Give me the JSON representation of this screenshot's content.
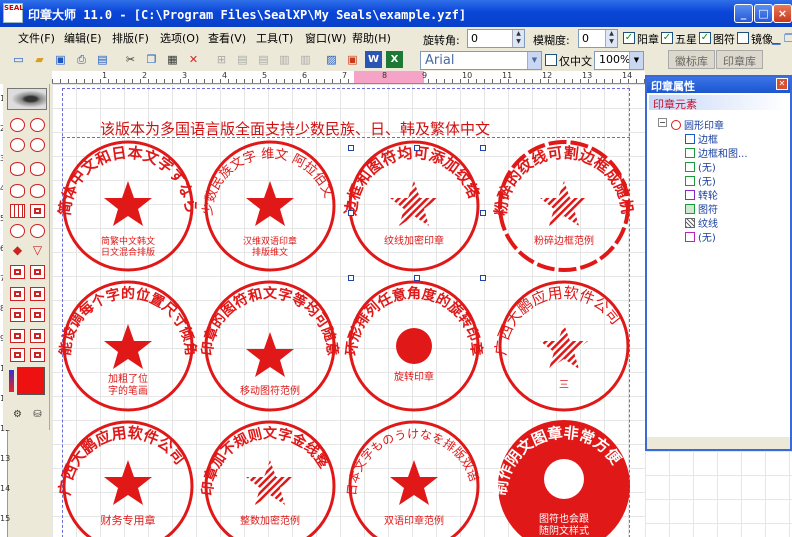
{
  "window": {
    "title": "印章大师 11.0 - [C:\\Program Files\\SealXP\\My Seals\\example.yzf]",
    "icon_label": "SEAL"
  },
  "menu": {
    "items": [
      {
        "label": "文件(F)"
      },
      {
        "label": "编辑(E)"
      },
      {
        "label": "排版(F)"
      },
      {
        "label": "选项(O)"
      },
      {
        "label": "查看(V)"
      },
      {
        "label": "工具(T)"
      },
      {
        "label": "窗口(W)"
      },
      {
        "label": "帮助(H)"
      }
    ]
  },
  "propbar": {
    "rotate_label": "旋转角:",
    "rotate_value": "0",
    "blur_label": "模糊度:",
    "blur_value": "0",
    "checks": [
      {
        "label": "阳章",
        "checked": true
      },
      {
        "label": "五星",
        "checked": true
      },
      {
        "label": "图符",
        "checked": true
      },
      {
        "label": "镜像",
        "checked": false
      }
    ]
  },
  "fontbar": {
    "font": "Arial",
    "only_chinese_label": "仅中文",
    "zoom": "100%"
  },
  "library_tabs": [
    "徽标库",
    "印章库"
  ],
  "ruler": {
    "h_numbers": [
      "1",
      "2",
      "3",
      "4",
      "5",
      "6",
      "7",
      "8",
      "9",
      "10",
      "11",
      "12",
      "13",
      "14"
    ],
    "v_numbers": [
      "1",
      "2",
      "3",
      "4",
      "5",
      "6",
      "7",
      "8",
      "9",
      "10",
      "11",
      "12",
      "13",
      "14",
      "15"
    ]
  },
  "canvas": {
    "banner": "该版本为多国语言版全面支持少数民族、日、韩及繁体中文",
    "seals": [
      {
        "ring": "简体中文和日本文字すならの繁體中文",
        "center": "简繁中文韩文\n日文混合排版"
      },
      {
        "ring": "少数民族文字 维文 阿拉伯文",
        "center": "汉维双语印章\n排版维文"
      },
      {
        "ring": "边框和图符均可添加纹络",
        "center": "纹线加密印章"
      },
      {
        "ring": "粉碎的纹线可割边框成随机碎片",
        "center": "粉碎边框范例"
      },
      {
        "ring": "能设调每个字的位置尺寸倾角笔画",
        "center": "加粗了位\n字的笔画"
      },
      {
        "ring": "印章的图符和文字等均可随意移动",
        "center": "移动图符范例"
      },
      {
        "ring": "环形排列任意角度的旋转印章",
        "center": "旋转印章"
      },
      {
        "ring": "广西大鹏应用软件公司",
        "center": "三"
      },
      {
        "ring": "广西大鹏应用软件公司",
        "center": "财务专用章"
      },
      {
        "ring": "印章加不规则文字金线整",
        "center": "整数加密范例"
      },
      {
        "ring": "日本文字ものうけなを排版双语",
        "center": "双语印章范例"
      },
      {
        "ring": "制作阴文图章非常方便",
        "center": "图符也会跟\n随阴文样式"
      }
    ]
  },
  "right_panel": {
    "title": "印章属性",
    "section": "印章元素",
    "root": "圆形印章",
    "items": [
      {
        "label": "边框",
        "icon": "border-icon"
      },
      {
        "label": "边框和图...",
        "icon": "text-ring-icon"
      },
      {
        "label": "(无)",
        "icon": "text-icon"
      },
      {
        "label": "(无)",
        "icon": "text-icon"
      },
      {
        "label": "转轮",
        "icon": "wheel-icon"
      },
      {
        "label": "图符",
        "icon": "image-icon"
      },
      {
        "label": "纹线",
        "icon": "hatch-icon"
      },
      {
        "label": "(无)",
        "icon": "number-icon"
      }
    ]
  },
  "colors": {
    "seal_red": "#e01818",
    "title_blue": "#0a45d8",
    "panel_blue": "#3a6ad8"
  }
}
